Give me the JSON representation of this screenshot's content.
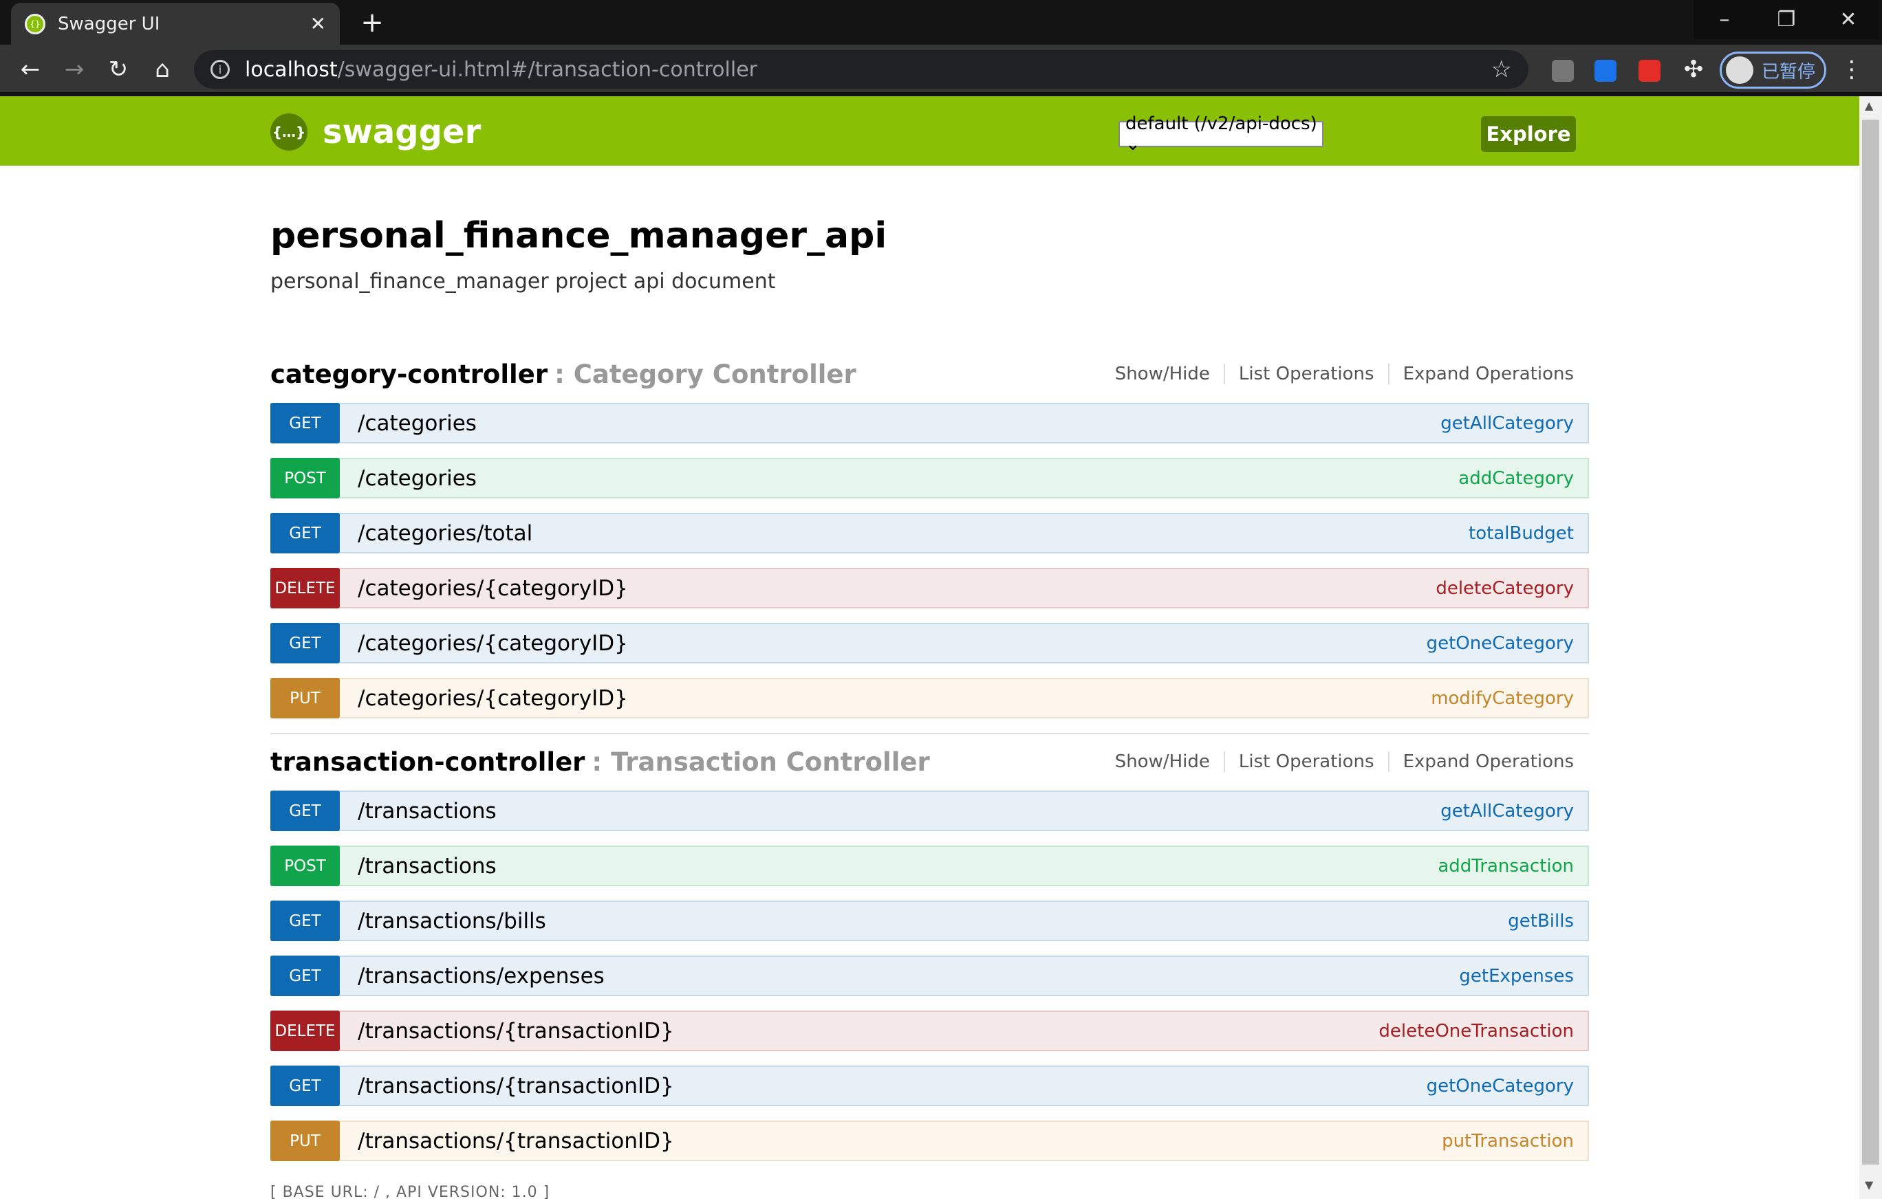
{
  "browser": {
    "tab_title": "Swagger UI",
    "url_host": "localhost",
    "url_path": "/swagger-ui.html#/transaction-controller",
    "profile_label": "已暂停"
  },
  "header": {
    "logo_text": "swagger",
    "spec_select": "default (/v2/api-docs) ⌄",
    "explore_label": "Explore"
  },
  "info": {
    "title": "personal_finance_manager_api",
    "description": "personal_finance_manager project api document"
  },
  "links": {
    "show_hide": "Show/Hide",
    "list_ops": "List Operations",
    "expand_ops": "Expand Operations"
  },
  "controllers": [
    {
      "name": "category-controller",
      "desc": ": Category Controller",
      "ops": [
        {
          "method": "GET",
          "path": "/categories",
          "name": "getAllCategory"
        },
        {
          "method": "POST",
          "path": "/categories",
          "name": "addCategory"
        },
        {
          "method": "GET",
          "path": "/categories/total",
          "name": "totalBudget"
        },
        {
          "method": "DELETE",
          "path": "/categories/{categoryID}",
          "name": "deleteCategory"
        },
        {
          "method": "GET",
          "path": "/categories/{categoryID}",
          "name": "getOneCategory"
        },
        {
          "method": "PUT",
          "path": "/categories/{categoryID}",
          "name": "modifyCategory"
        }
      ]
    },
    {
      "name": "transaction-controller",
      "desc": ": Transaction Controller",
      "ops": [
        {
          "method": "GET",
          "path": "/transactions",
          "name": "getAllCategory"
        },
        {
          "method": "POST",
          "path": "/transactions",
          "name": "addTransaction"
        },
        {
          "method": "GET",
          "path": "/transactions/bills",
          "name": "getBills"
        },
        {
          "method": "GET",
          "path": "/transactions/expenses",
          "name": "getExpenses"
        },
        {
          "method": "DELETE",
          "path": "/transactions/{transactionID}",
          "name": "deleteOneTransaction"
        },
        {
          "method": "GET",
          "path": "/transactions/{transactionID}",
          "name": "getOneCategory"
        },
        {
          "method": "PUT",
          "path": "/transactions/{transactionID}",
          "name": "putTransaction"
        }
      ]
    }
  ],
  "footer": {
    "text": "[ BASE URL: / , API VERSION: 1.0 ]"
  }
}
